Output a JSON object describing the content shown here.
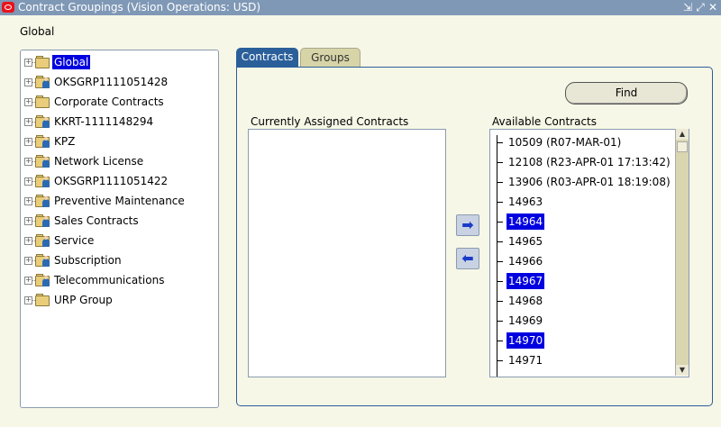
{
  "window": {
    "title": "Contract Groupings (Vision Operations: USD)"
  },
  "breadcrumb": "Global",
  "tree": {
    "items": [
      {
        "label": "Global",
        "selected": true
      },
      {
        "label": "OKSGRP1111051428",
        "selected": false
      },
      {
        "label": "Corporate Contracts",
        "selected": false
      },
      {
        "label": "KKRT-1111148294",
        "selected": false
      },
      {
        "label": "KPZ",
        "selected": false
      },
      {
        "label": "Network License",
        "selected": false
      },
      {
        "label": "OKSGRP1111051422",
        "selected": false
      },
      {
        "label": "Preventive Maintenance",
        "selected": false
      },
      {
        "label": "Sales Contracts",
        "selected": false
      },
      {
        "label": "Service",
        "selected": false
      },
      {
        "label": "Subscription",
        "selected": false
      },
      {
        "label": "Telecommunications",
        "selected": false
      },
      {
        "label": "URP Group",
        "selected": false
      }
    ]
  },
  "tabs": [
    {
      "label": "Contracts",
      "active": true
    },
    {
      "label": "Groups",
      "active": false
    }
  ],
  "find_button": "Find",
  "assigned": {
    "label": "Currently Assigned Contracts",
    "items": []
  },
  "available": {
    "label": "Available Contracts",
    "items": [
      {
        "label": "10509 (R07-MAR-01)",
        "selected": false
      },
      {
        "label": "12108 (R23-APR-01 17:13:42)",
        "selected": false
      },
      {
        "label": "13906 (R03-APR-01 18:19:08)",
        "selected": false
      },
      {
        "label": "14963",
        "selected": false
      },
      {
        "label": "14964",
        "selected": true
      },
      {
        "label": "14965",
        "selected": false
      },
      {
        "label": "14966",
        "selected": false
      },
      {
        "label": "14967",
        "selected": true
      },
      {
        "label": "14968",
        "selected": false
      },
      {
        "label": "14969",
        "selected": false
      },
      {
        "label": "14970",
        "selected": true
      },
      {
        "label": "14971",
        "selected": false
      }
    ]
  },
  "colors": {
    "selection": "#0000e0",
    "titlebar": "#7f98b6",
    "tab_active": "#2a5f9a"
  }
}
